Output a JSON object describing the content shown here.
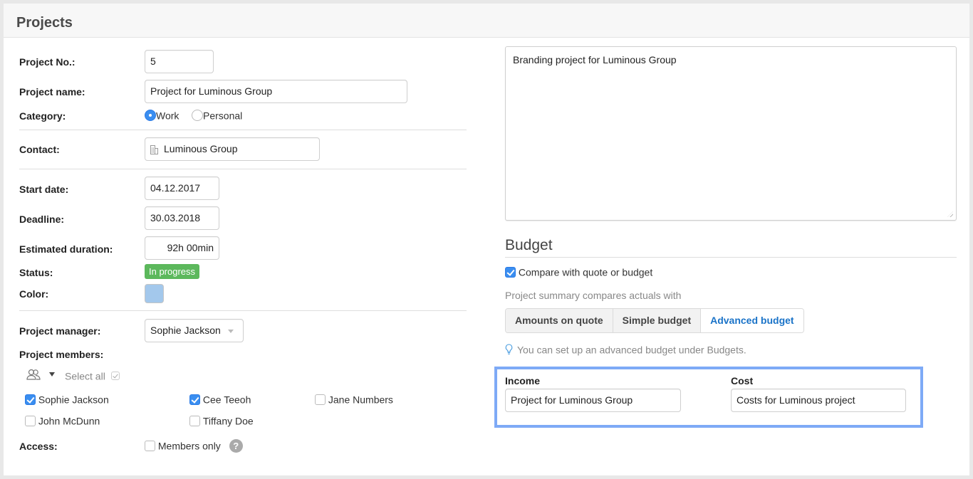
{
  "header": {
    "title": "Projects"
  },
  "form": {
    "project_no": {
      "label": "Project No.:",
      "value": "5"
    },
    "project_name": {
      "label": "Project name:",
      "value": "Project for Luminous Group"
    },
    "category": {
      "label": "Category:",
      "options": [
        {
          "label": "Work",
          "selected": true
        },
        {
          "label": "Personal",
          "selected": false
        }
      ]
    },
    "contact": {
      "label": "Contact:",
      "value": "Luminous Group",
      "icon": "building-icon"
    },
    "start_date": {
      "label": "Start date:",
      "value": "04.12.2017"
    },
    "deadline": {
      "label": "Deadline:",
      "value": "30.03.2018"
    },
    "estimated_duration": {
      "label": "Estimated duration:",
      "value": "92h 00min"
    },
    "status": {
      "label": "Status:",
      "value": "In progress",
      "color": "#5cb85c"
    },
    "color": {
      "label": "Color:",
      "value": "#a3c8ec"
    },
    "project_manager": {
      "label": "Project manager:",
      "value": "Sophie Jackson"
    },
    "project_members": {
      "label": "Project members:",
      "select_all_label": "Select all",
      "members": [
        {
          "name": "Sophie Jackson",
          "checked": true
        },
        {
          "name": "Cee Teeoh",
          "checked": true
        },
        {
          "name": "Jane Numbers",
          "checked": false
        },
        {
          "name": "John McDunn",
          "checked": false
        },
        {
          "name": "Tiffany Doe",
          "checked": false
        }
      ]
    },
    "access": {
      "label": "Access:",
      "option_label": "Members only",
      "checked": false,
      "help": "?"
    }
  },
  "description": {
    "value": "Branding project for Luminous Group"
  },
  "budget": {
    "title": "Budget",
    "compare_label": "Compare with quote or budget",
    "compare_checked": true,
    "summary_text": "Project summary compares actuals with",
    "modes": [
      {
        "label": "Amounts on quote",
        "active": false
      },
      {
        "label": "Simple budget",
        "active": false
      },
      {
        "label": "Advanced budget",
        "active": true
      }
    ],
    "hint": "You can set up an advanced budget under Budgets.",
    "income": {
      "label": "Income",
      "value": "Project for Luminous Group"
    },
    "cost": {
      "label": "Cost",
      "value": "Costs for Luminous project"
    }
  },
  "colors": {
    "accent": "#1a73c8",
    "checkbox": "#3a8ef0",
    "highlight": "#7eaaf6"
  }
}
